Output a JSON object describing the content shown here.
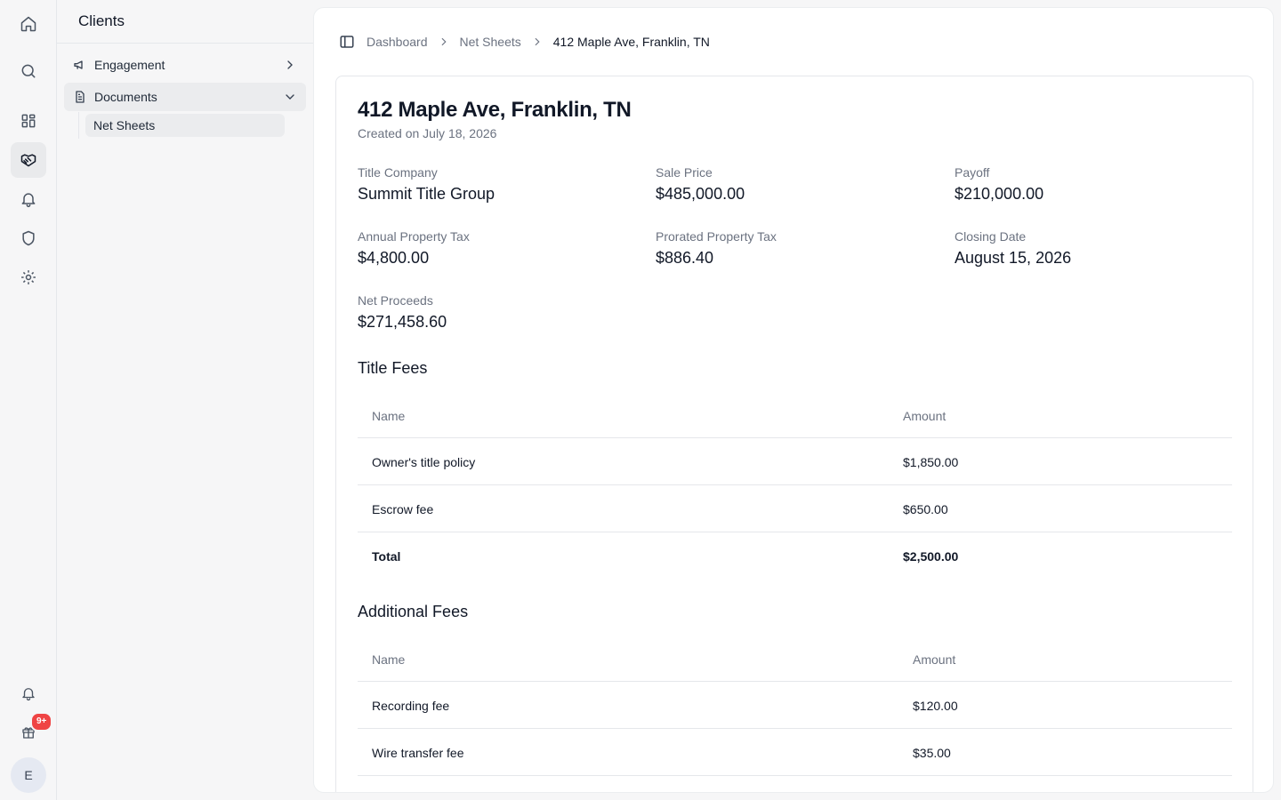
{
  "rail": {
    "badge": "9+",
    "avatar_initial": "E"
  },
  "sidebar": {
    "title": "Clients",
    "items": [
      {
        "label": "Engagement"
      },
      {
        "label": "Documents"
      }
    ],
    "subitems": [
      {
        "label": "Net Sheets"
      }
    ]
  },
  "breadcrumb": {
    "items": [
      "Dashboard",
      "Net Sheets"
    ],
    "current": "412 Maple Ave, Franklin, TN"
  },
  "sheet": {
    "title": "412 Maple Ave, Franklin, TN",
    "created": "Created on July 18, 2026",
    "fields": [
      {
        "label": "Title Company",
        "value": "Summit Title Group"
      },
      {
        "label": "Sale Price",
        "value": "$485,000.00"
      },
      {
        "label": "Payoff",
        "value": "$210,000.00"
      },
      {
        "label": "Annual Property Tax",
        "value": "$4,800.00"
      },
      {
        "label": "Prorated Property Tax",
        "value": "$886.40"
      },
      {
        "label": "Closing Date",
        "value": "August 15, 2026"
      },
      {
        "label": "Net Proceeds",
        "value": "$271,458.60"
      }
    ]
  },
  "title_fees": {
    "heading": "Title Fees",
    "columns": [
      "Name",
      "Amount"
    ],
    "rows": [
      {
        "name": "Owner's title policy",
        "amount": "$1,850.00"
      },
      {
        "name": "Escrow fee",
        "amount": "$650.00"
      }
    ],
    "total": {
      "name": "Total",
      "amount": "$2,500.00"
    }
  },
  "additional_fees": {
    "heading": "Additional Fees",
    "columns": [
      "Name",
      "Amount"
    ],
    "rows": [
      {
        "name": "Recording fee",
        "amount": "$120.00"
      },
      {
        "name": "Wire transfer fee",
        "amount": "$35.00"
      }
    ]
  }
}
